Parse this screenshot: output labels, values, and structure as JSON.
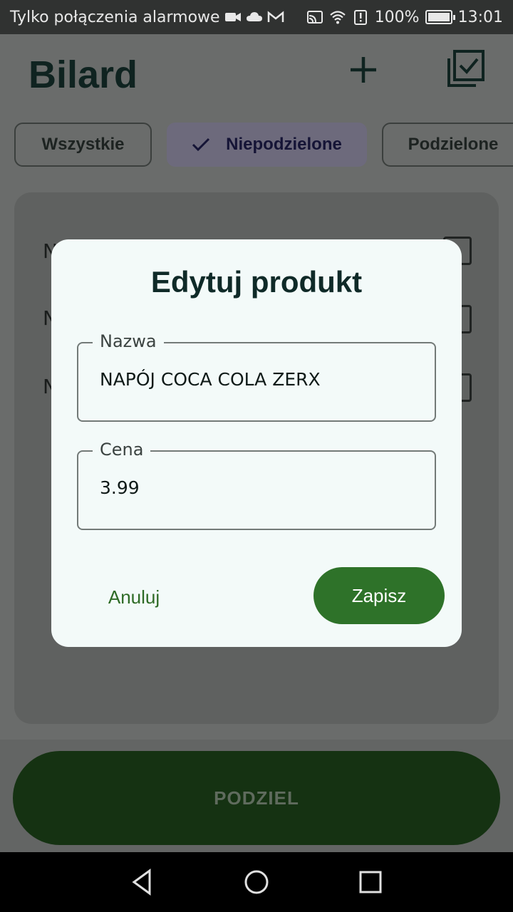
{
  "status_bar": {
    "carrier_text": "Tylko połączenia alarmowe",
    "icons_left": [
      "video-icon",
      "cloud-icon",
      "gmail-icon"
    ],
    "icons_right": [
      "cast-icon",
      "wifi-icon",
      "alert-icon",
      "battery-icon"
    ],
    "battery": "100%",
    "battery_level": 1.0,
    "time": "13:01"
  },
  "app": {
    "title": "Bilard",
    "filters": [
      {
        "label": "Wszystkie",
        "selected": false
      },
      {
        "label": "Niepodzielone",
        "selected": true
      },
      {
        "label": "Podzielone",
        "selected": false
      }
    ],
    "list_rows": [
      "N",
      "N",
      "N"
    ],
    "main_button": "PODZIEL"
  },
  "dialog": {
    "title": "Edytuj produkt",
    "name_label": "Nazwa",
    "name_value": "NAPÓJ COCA COLA ZERX",
    "price_label": "Cena",
    "price_value": "3.99",
    "cancel": "Anuluj",
    "save": "Zapisz"
  },
  "colors": {
    "accent": "#2e7229",
    "dialog_bg": "#f3faf9",
    "scrim": "#6a6c6b"
  }
}
